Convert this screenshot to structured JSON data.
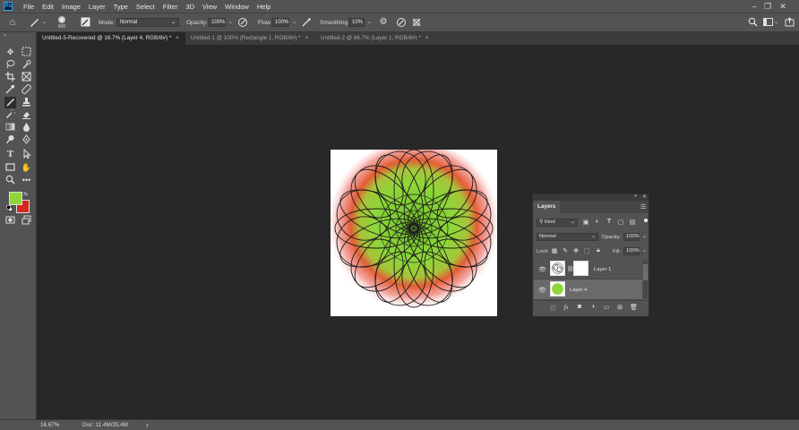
{
  "menubar": {
    "app_logo": "Ps",
    "items": [
      "File",
      "Edit",
      "Image",
      "Layer",
      "Type",
      "Select",
      "Filter",
      "3D",
      "View",
      "Window",
      "Help"
    ]
  },
  "options": {
    "brush_size": "600",
    "mode_label": "Mode:",
    "mode_value": "Normal",
    "opacity_label": "Opacity:",
    "opacity_value": "100%",
    "flow_label": "Flow:",
    "flow_value": "100%",
    "smoothing_label": "Smoothing:",
    "smoothing_value": "10%"
  },
  "tabs": [
    {
      "title": "Untitled-5-Recovered @ 16.7% (Layer 4, RGB/8#) *",
      "close": "×"
    },
    {
      "title": "Untitled-1 @ 100% (Rectangle 1, RGB/8#) *",
      "close": "×"
    },
    {
      "title": "Untitled-2 @ 66.7% (Layer 1, RGB/8#) *",
      "close": "×"
    }
  ],
  "colors": {
    "foreground": "#8fd63a",
    "background": "#d42a1e",
    "accent": "#31a8ff"
  },
  "layers_panel": {
    "tab_label": "Layers",
    "filter_label": "Kind",
    "blend_mode": "Normal",
    "opacity_label": "Opacity:",
    "opacity_value": "100%",
    "lock_label": "Lock:",
    "fill_label": "Fill:",
    "fill_value": "100%",
    "layers": [
      {
        "name": "Layer 1",
        "selected": false
      },
      {
        "name": "Layer 4",
        "selected": true
      }
    ]
  },
  "status": {
    "zoom": "16.67%",
    "doc_info": "Doc: 11.4M/25.4M",
    "arrow": "›"
  }
}
